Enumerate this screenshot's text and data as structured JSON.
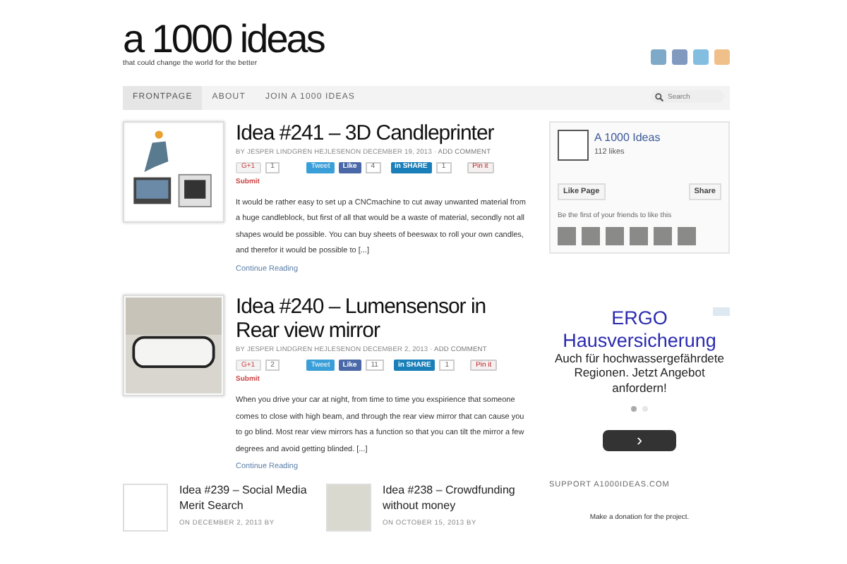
{
  "site": {
    "title": "a 1000 ideas",
    "tagline": "that could change the world for the better"
  },
  "nav": [
    {
      "label": "FRONTPAGE",
      "selected": true
    },
    {
      "label": "ABOUT",
      "selected": false
    },
    {
      "label": "JOIN A 1000 IDEAS",
      "selected": false
    }
  ],
  "search": {
    "placeholder": "Search"
  },
  "posts": [
    {
      "title": "Idea #241 – 3D Candleprinter",
      "meta": "BY JESPER LINDGREN HEJLESENON DECEMBER 19, 2013 ·",
      "comment_link": "ADD COMMENT",
      "gplus": "G+1",
      "gplus_count": "1",
      "tweet": "Tweet",
      "like": "Like",
      "like_count": "4",
      "share": "in SHARE",
      "share_count": "1",
      "pin": "Pin it",
      "submit": "Submit",
      "excerpt": "It would be rather easy to set up a CNCmachine to cut away unwanted material from a huge candleblock, but first of all that would be a waste of material, secondly not all shapes would be possible. You can buy sheets of beeswax to roll your own candles, and therefor it would be possible to [...]",
      "more": "Continue Reading"
    },
    {
      "title": "Idea #240 – Lumensensor in Rear view mirror",
      "meta": "BY JESPER LINDGREN HEJLESENON DECEMBER 2, 2013 ·",
      "comment_link": "ADD COMMENT",
      "gplus": "G+1",
      "gplus_count": "2",
      "tweet": "Tweet",
      "like": "Like",
      "like_count": "11",
      "share": "in SHARE",
      "share_count": "1",
      "pin": "Pin it",
      "submit": "Submit",
      "excerpt": "When you drive your car at night, from time to time you exspirience that someone comes to close with high beam, and through the rear view mirror that can cause you to go blind. Most rear view mirrors has a function so that you can tilt the mirror a few degrees and avoid getting blinded. [...]",
      "more": "Continue Reading"
    }
  ],
  "small_posts": [
    {
      "title": "Idea #239 – Social Media Merit Search",
      "meta": "ON DECEMBER 2, 2013 BY"
    },
    {
      "title": "Idea #238 – Crowdfunding without money",
      "meta": "ON OCTOBER 15, 2013 BY"
    }
  ],
  "sidebar": {
    "fb": {
      "page_name": "A 1000 Ideas",
      "likes": "112 likes",
      "like_button": "Like Page",
      "share_button": "Share",
      "friends_text": "Be the first of your friends to like this"
    },
    "ad": {
      "title": "ERGO Hausversicherung",
      "body": "Auch für hochwassergefährdete Regionen. Jetzt Angebot anfordern!",
      "button": "›",
      "dots": [
        {
          "selected": true
        },
        {
          "selected": false
        }
      ]
    },
    "support": {
      "heading": "SUPPORT A1000IDEAS.COM",
      "text": "Make a donation for the project."
    }
  }
}
